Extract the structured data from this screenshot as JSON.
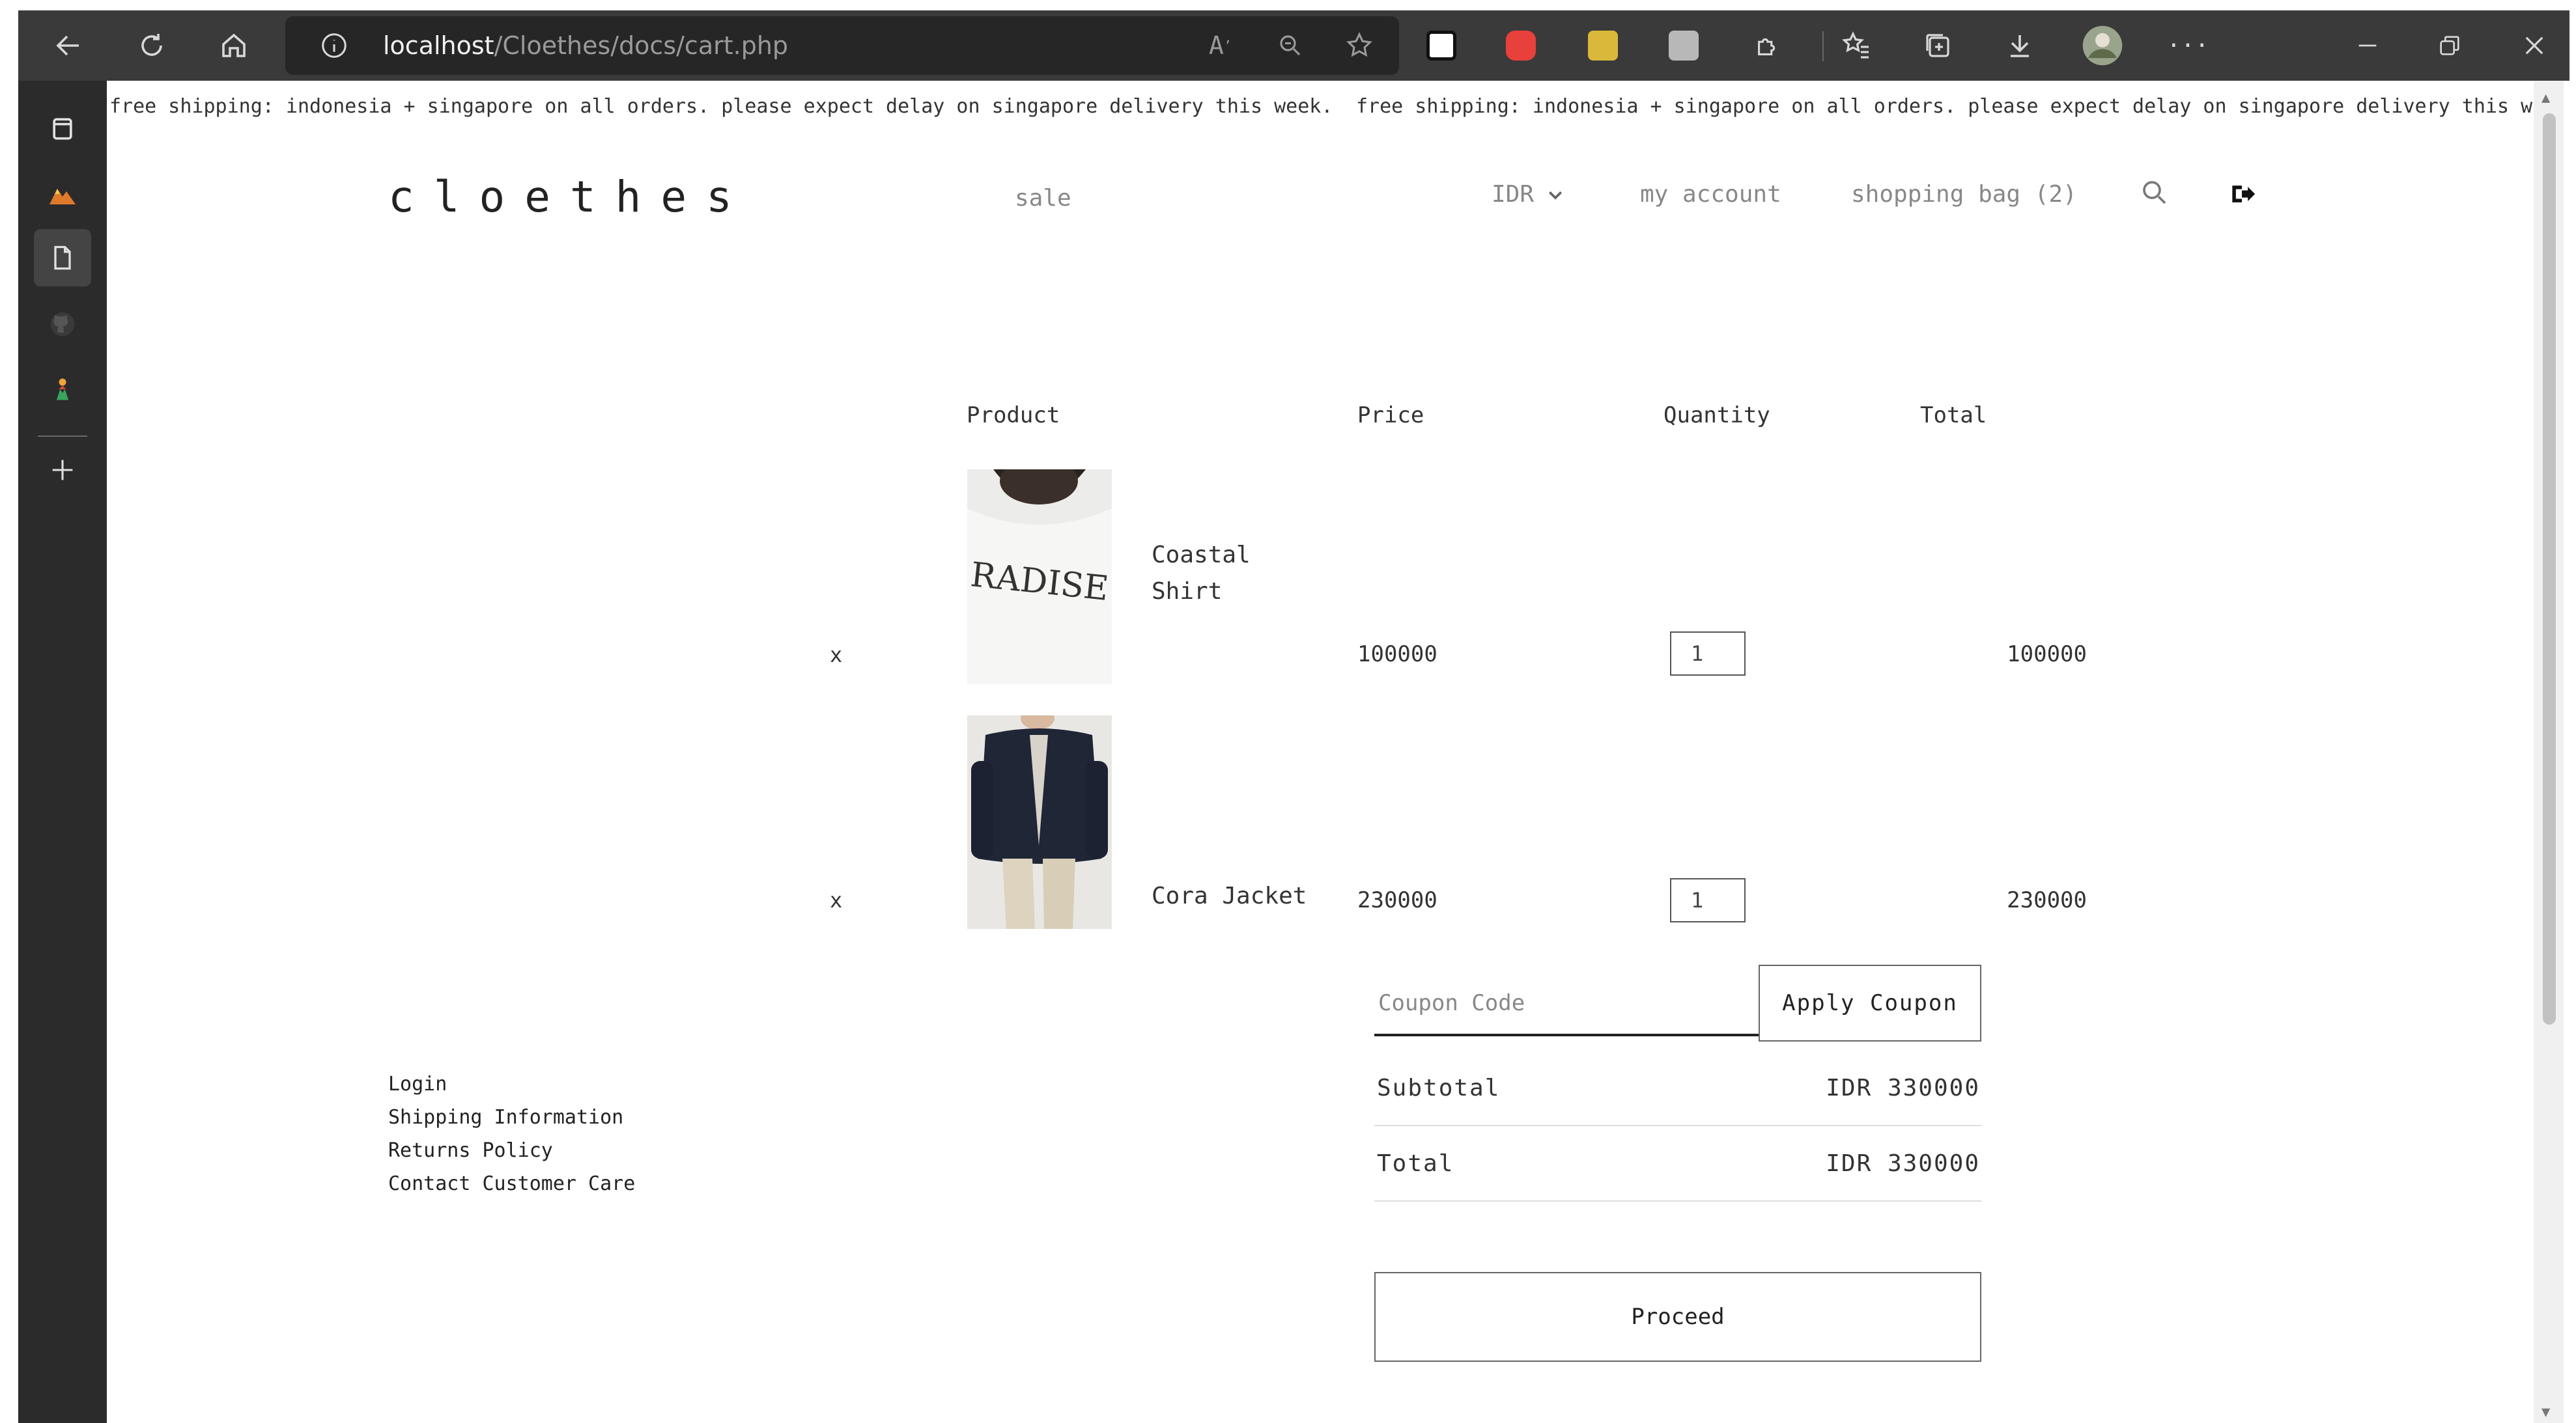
{
  "browser": {
    "url_host": "localhost",
    "url_path": "/Cloethes/docs/cart.php",
    "read_aloud_label": "A"
  },
  "page": {
    "banner": "free shipping: indonesia + singapore on all orders. please expect delay on singapore delivery this week.",
    "logo": "cloethes",
    "nav": {
      "sale": "sale",
      "currency": "IDR",
      "account": "my account",
      "bag": "shopping bag (2)"
    },
    "table_headers": {
      "product": "Product",
      "price": "Price",
      "quantity": "Quantity",
      "total": "Total"
    },
    "items": [
      {
        "remove": "x",
        "name_line1": "Coastal",
        "name_line2": "Shirt",
        "price": "100000",
        "quantity": "1",
        "total": "100000",
        "print_text": "RADISE"
      },
      {
        "remove": "x",
        "name_line1": "Cora Jacket",
        "name_line2": "",
        "price": "230000",
        "quantity": "1",
        "total": "230000"
      }
    ],
    "coupon": {
      "placeholder": "Coupon Code",
      "button": "Apply Coupon"
    },
    "summary": {
      "subtotal_label": "Subtotal",
      "subtotal_value": "IDR 330000",
      "total_label": "Total",
      "total_value": "IDR 330000"
    },
    "proceed": "Proceed",
    "footer_links": [
      "Login",
      "Shipping Information",
      "Returns Policy",
      "Contact Customer Care"
    ]
  },
  "colors": {
    "toolbar": "#3a3a3a",
    "sidebar": "#2b2b2b",
    "page_bg": "#ffffff",
    "text": "#222222",
    "muted_text": "#888888"
  }
}
